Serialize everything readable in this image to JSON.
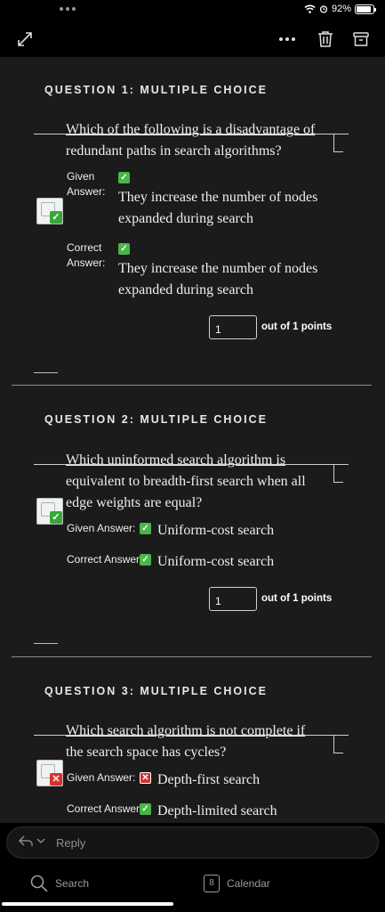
{
  "status_bar": {
    "battery_pct": "92%"
  },
  "toolbar": {
    "expand_icon": "expand-arrows-icon",
    "more_icon": "more-dots-icon",
    "trash_icon": "trash-icon",
    "archive_icon": "archive-icon"
  },
  "questions": [
    {
      "header": "QUESTION 1:   MULTIPLE CHOICE",
      "text_first": "Which of the following is a disadvantage of",
      "text_rest": "redundant paths in search algorithms?",
      "given_label_1": "Given",
      "given_label_2": "Answer:",
      "given_answer_1": "They increase the number of nodes",
      "given_answer_2": "expanded during search",
      "correct_label_1": "Correct",
      "correct_label_2": "Answer:",
      "correct_answer_1": "They increase the number of nodes",
      "correct_answer_2": "expanded during search",
      "points_value": "1",
      "points_text": "out of 1 points"
    },
    {
      "header": "QUESTION 2:   MULTIPLE CHOICE",
      "text_first": "Which uninformed search algorithm is",
      "text_2": "equivalent to breadth-first search when all",
      "text_3": "edge weights are equal?",
      "given_label": "Given Answer:",
      "given_answer": "Uniform-cost search",
      "correct_label": "Correct Answer:",
      "correct_answer": "Uniform-cost search",
      "points_value": "1",
      "points_text": "out of 1 points"
    },
    {
      "header": "QUESTION 3:   MULTIPLE CHOICE",
      "text_first": "Which search algorithm is not complete if",
      "text_rest": "the search space has cycles?",
      "given_label": "Given Answer:",
      "given_answer": "Depth-first search",
      "correct_label": "Correct Answer:",
      "correct_answer": "Depth-limited search"
    }
  ],
  "reply": {
    "placeholder": "Reply"
  },
  "bottom_nav": {
    "search_label": "Search",
    "calendar_label": "Calendar",
    "calendar_day": "8"
  }
}
